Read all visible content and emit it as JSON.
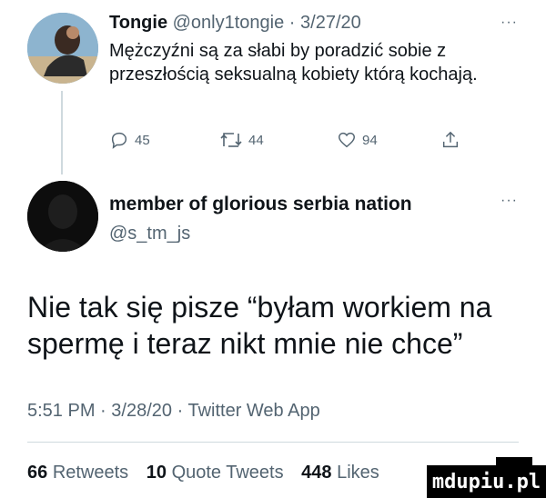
{
  "tweet1": {
    "display_name": "Tongie",
    "handle": "@only1tongie",
    "separator": "·",
    "date": "3/27/20",
    "more": "···",
    "text": "Mężczyźni są za słabi by poradzić sobie z przeszłością seksualną kobiety którą kochają.",
    "actions": {
      "replies": "45",
      "retweets": "44",
      "likes": "94"
    }
  },
  "quote": {
    "display_name": "member of glorious serbia nation",
    "handle": "@s_tm_js",
    "more": "···",
    "text": "Nie tak się pisze “byłam workiem na spermę i teraz nikt mnie nie chce”",
    "time": "5:51 PM",
    "separator": "·",
    "date": "3/28/20",
    "source": "Twitter Web App"
  },
  "stats": {
    "retweets_count": "66",
    "retweets_label": "Retweets",
    "quotes_count": "10",
    "quotes_label": "Quote Tweets",
    "likes_count": "448",
    "likes_label": "Likes"
  },
  "watermark": "mdupiu.pl",
  "icons": [
    "reply-icon",
    "retweet-icon",
    "like-icon",
    "share-icon",
    "more-icon"
  ],
  "colors": {
    "text": "#0f1419",
    "muted": "#536471",
    "divider": "#cfd9de"
  }
}
